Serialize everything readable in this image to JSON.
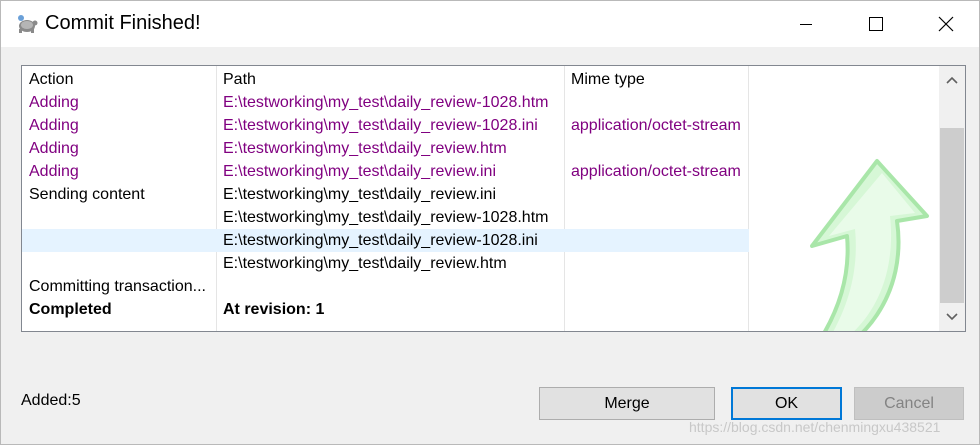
{
  "window": {
    "title": "Commit Finished!"
  },
  "columns": {
    "action": "Action",
    "path": "Path",
    "mime": "Mime type"
  },
  "rows": [
    {
      "action": "Adding",
      "path": "E:\\testworking\\my_test\\daily_review-1028.htm",
      "mime": ""
    },
    {
      "action": "Adding",
      "path": "E:\\testworking\\my_test\\daily_review-1028.ini",
      "mime": "application/octet-stream"
    },
    {
      "action": "Adding",
      "path": "E:\\testworking\\my_test\\daily_review.htm",
      "mime": ""
    },
    {
      "action": "Adding",
      "path": "E:\\testworking\\my_test\\daily_review.ini",
      "mime": "application/octet-stream"
    },
    {
      "action": "Sending content",
      "path": "E:\\testworking\\my_test\\daily_review.ini",
      "mime": ""
    },
    {
      "action": "",
      "path": "E:\\testworking\\my_test\\daily_review-1028.htm",
      "mime": ""
    },
    {
      "action": "",
      "path": "E:\\testworking\\my_test\\daily_review-1028.ini",
      "mime": ""
    },
    {
      "action": "",
      "path": "E:\\testworking\\my_test\\daily_review.htm",
      "mime": ""
    },
    {
      "action": "Committing transaction...",
      "path": "",
      "mime": ""
    },
    {
      "action": "Completed",
      "path": "At revision: 1",
      "mime": ""
    }
  ],
  "footer": {
    "added": "Added:5",
    "merge": "Merge",
    "ok": "OK",
    "cancel": "Cancel"
  },
  "watermark": "https://blog.csdn.net/chenmingxu438521",
  "colors": {
    "added_text": "#800080",
    "hover_row": "#e5f3ff",
    "default_button_border": "#0078d7"
  }
}
